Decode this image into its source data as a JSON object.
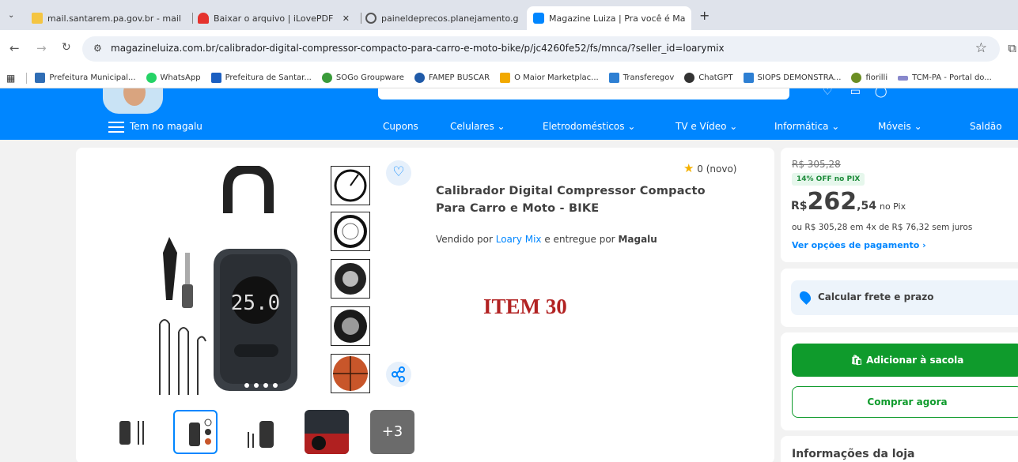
{
  "browser": {
    "tabs": [
      {
        "title": "mail.santarem.pa.gov.br - mail",
        "icon": "mail-icon",
        "color": "#f4c542"
      },
      {
        "title": "Baixar o arquivo | iLovePDF",
        "icon": "ilovepdf-icon",
        "color": "#e5322d"
      },
      {
        "title": "paineldeprecos.planejamento.g",
        "icon": "globe-icon",
        "color": "#555555"
      },
      {
        "title": "Magazine Luiza | Pra você é Ma",
        "icon": "magalu-icon",
        "color": "#0086ff"
      }
    ],
    "url": "magazineluiza.com.br/calibrador-digital-compressor-compacto-para-carro-e-moto-bike/p/jc4260fe52/fs/mnca/?seller_id=loarymix",
    "bookmarks": [
      {
        "label": "Prefeitura Municipal...",
        "icon": "prefeitura-icon",
        "color": "#2f6db5"
      },
      {
        "label": "WhatsApp",
        "icon": "whatsapp-icon",
        "color": "#25d366"
      },
      {
        "label": "Prefeitura de Santar...",
        "icon": "d-icon",
        "color": "#1b5fc1"
      },
      {
        "label": "SOGo Groupware",
        "icon": "sogo-icon",
        "color": "#3a9b3a"
      },
      {
        "label": "FAMEP BUSCAR",
        "icon": "famep-icon",
        "color": "#1f5aa8"
      },
      {
        "label": "O Maior Marketplac...",
        "icon": "marketplace-icon",
        "color": "#f2a900"
      },
      {
        "label": "Transferegov",
        "icon": "transferegov-icon",
        "color": "#2d7fd3"
      },
      {
        "label": "ChatGPT",
        "icon": "chatgpt-icon",
        "color": "#333333"
      },
      {
        "label": "SIOPS DEMONSTRA...",
        "icon": "siops-icon",
        "color": "#2d7fd3"
      },
      {
        "label": "fiorilli",
        "icon": "fiorilli-icon",
        "color": "#6b8e23"
      },
      {
        "label": "TCM-PA - Portal do...",
        "icon": "tcm-icon",
        "color": "#8888cc"
      }
    ]
  },
  "site": {
    "brand_color": "#0086ff",
    "menu_label": "Tem no magalu",
    "nav_items": [
      "Cupons",
      "Celulares",
      "Eletrodomésticos",
      "TV e Vídeo",
      "Informática",
      "Móveis",
      "Saldão"
    ]
  },
  "product": {
    "rating": "0 (novo)",
    "title": "Calibrador Digital Compressor Compacto Para Carro e Moto - BIKE",
    "sold_by_prefix": "Vendido por",
    "seller": "Loary Mix",
    "delivered_by_prefix": "e entregue por",
    "delivered_by": "Magalu",
    "more_images": "+3",
    "overlay_label": "ITEM 30",
    "display_reading": "25.0"
  },
  "pricing": {
    "old_price": "R$ 305,28",
    "discount": "14% OFF no PIX",
    "currency": "R$",
    "price_int": "262",
    "price_cents": ",54",
    "pix_label": "no Pix",
    "installments": "ou R$ 305,28 em 4x de R$ 76,32 sem juros",
    "payment_options": "Ver opções de pagamento"
  },
  "shipping": {
    "label": "Calcular frete e prazo"
  },
  "actions": {
    "add_to_bag": "Adicionar à sacola",
    "buy_now": "Comprar agora"
  },
  "store": {
    "title": "Informações da loja"
  }
}
